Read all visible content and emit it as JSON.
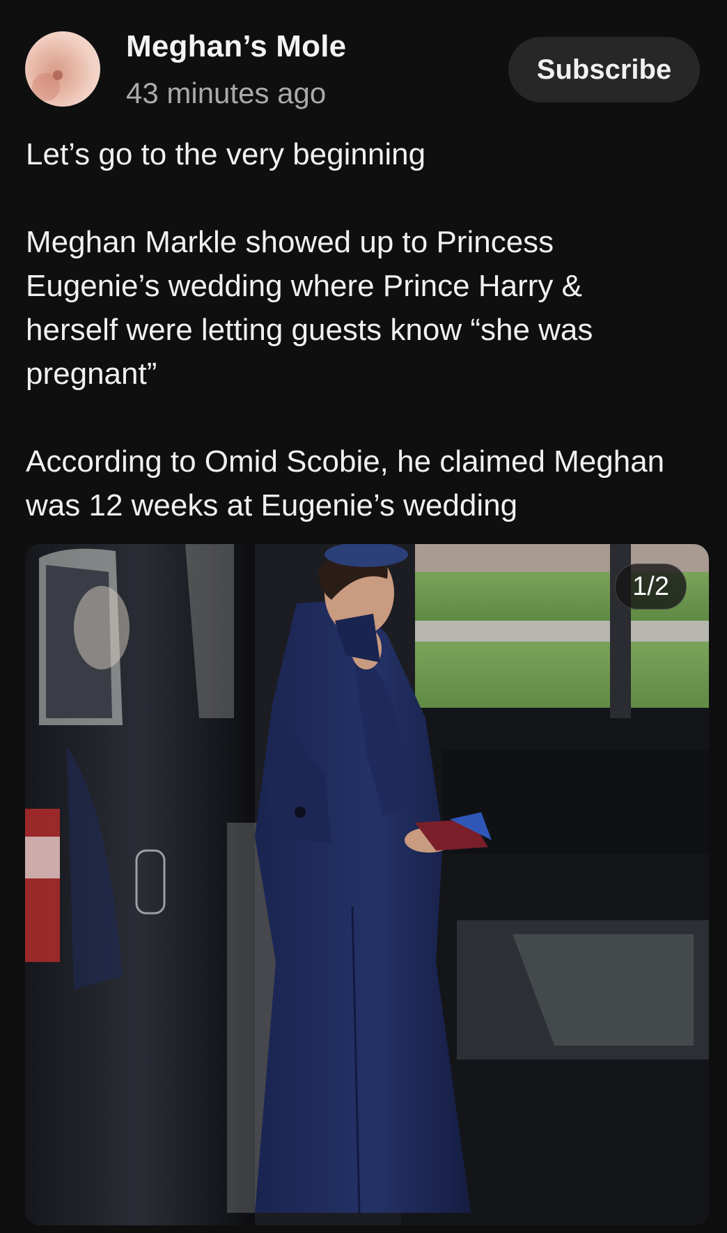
{
  "channel": {
    "name": "Meghan’s Mole",
    "posted": "43 minutes ago",
    "avatar_icon": "channel-avatar"
  },
  "subscribe_label": "Subscribe",
  "post": {
    "paragraphs": [
      [
        "Let’s go to the very beginning"
      ],
      [
        "Meghan Markle showed up to Princess",
        "Eugenie’s wedding where Prince Harry &",
        "herself were letting guests know “she was",
        "pregnant”"
      ],
      [
        "According to Omid Scobie, he claimed Meghan",
        "was 12 weeks at Eugenie’s wedding"
      ]
    ]
  },
  "media": {
    "counter": "1/2"
  },
  "colors": {
    "background": "#0f0f10",
    "button_bg": "#272727",
    "secondary_text": "#aaaaaa",
    "coat": "#1f2b5a"
  }
}
